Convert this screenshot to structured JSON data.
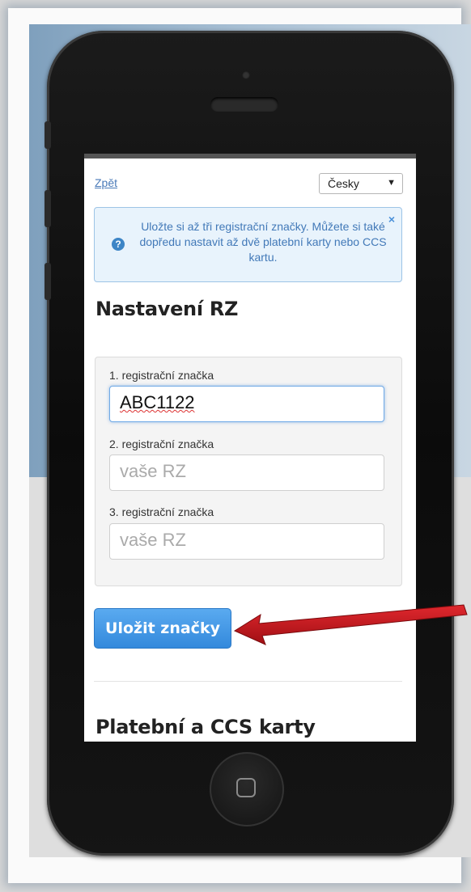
{
  "nav": {
    "back_label": "Zpět",
    "language": {
      "selected": "Česky",
      "arrow": "▼"
    }
  },
  "info": {
    "icon": "question-icon",
    "text": "Uložte si až tři registrační značky. Můžete si také dopředu nastavit až dvě platební karty nebo CCS kartu.",
    "close": "×"
  },
  "plates_section": {
    "title": "Nastavení RZ",
    "fields": [
      {
        "label": "1. registrační značka",
        "value": "ABC1122",
        "placeholder": "vaše RZ"
      },
      {
        "label": "2. registrační značka",
        "value": "",
        "placeholder": "vaše RZ"
      },
      {
        "label": "3. registrační značka",
        "value": "",
        "placeholder": "vaše RZ"
      }
    ],
    "save_label": "Uložit značky"
  },
  "cards_section": {
    "title": "Platební a CCS karty"
  },
  "colors": {
    "accent": "#3d85c6",
    "annotation_arrow": "#c4161c"
  }
}
